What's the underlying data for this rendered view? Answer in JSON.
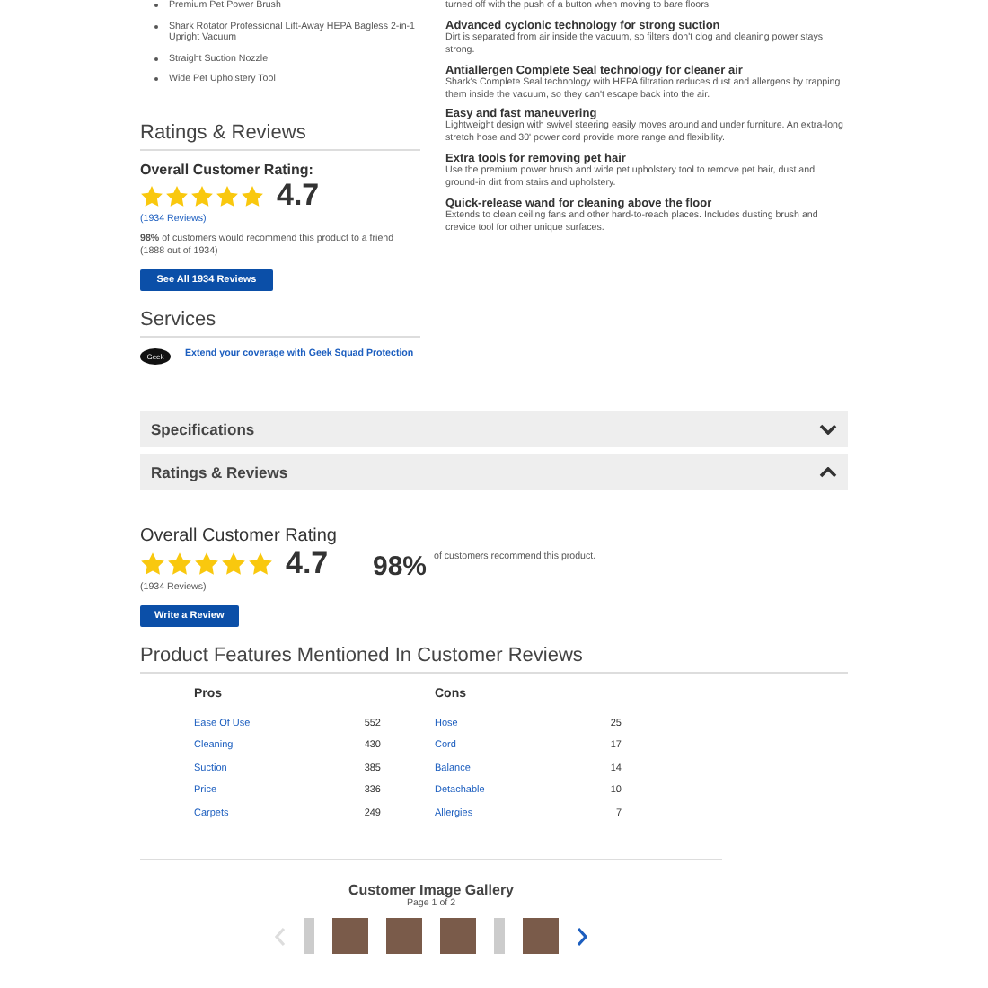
{
  "included_items": [
    "Premium Pet Power Brush",
    "Shark Rotator Professional Lift-Away HEPA Bagless 2-in-1 Upright Vacuum",
    "Straight Suction Nozzle",
    "Wide Pet Upholstery Tool"
  ],
  "features_intro": "turned off with the push of a button when moving to bare floors.",
  "features": [
    {
      "title": "Advanced cyclonic technology for strong suction",
      "text": "Dirt is separated from air inside the vacuum, so filters don't clog and cleaning power stays strong."
    },
    {
      "title": "Antiallergen Complete Seal technology for cleaner air",
      "text": "Shark's Complete Seal technology with HEPA filtration reduces dust and allergens by trapping them inside the vacuum, so they can't escape back into the air."
    },
    {
      "title": "Easy and fast maneuvering",
      "text": "Lightweight design with swivel steering easily moves around and under furniture. An extra-long stretch hose and 30' power cord provide more range and flexibility."
    },
    {
      "title": "Extra tools for removing pet hair",
      "text": "Use the premium power brush and wide pet upholstery tool to remove pet hair, dust and ground-in dirt from stairs and upholstery."
    },
    {
      "title": "Quick-release wand for cleaning above the floor",
      "text": "Extends to clean ceiling fans and other hard-to-reach places. Includes dusting brush and crevice tool for other unique surfaces."
    }
  ],
  "side_ratings": {
    "heading": "Ratings & Reviews",
    "label": "Overall Customer Rating:",
    "stars": 5,
    "score": "4.7",
    "reviews": "(1934 Reviews)",
    "recommend": "**98%** of customers would recommend this product to a friend (1888 out of 1934)",
    "button": "See All 1934 Reviews"
  },
  "services": {
    "heading": "Services",
    "logo": "Geek",
    "link": "Extend your coverage with Geek Squad Protection"
  },
  "accordion": [
    {
      "label": "Specifications",
      "expanded": false
    },
    {
      "label": "Ratings & Reviews",
      "expanded": true
    }
  ],
  "rating": {
    "heading": "Overall Customer Rating",
    "stars": 5,
    "score": "4.7",
    "reviews": "(1934 Reviews)",
    "percent": "98%",
    "percent_text": "of customers recommend this product.",
    "button": "Write a Review"
  },
  "features_mentioned": {
    "heading": "Product Features Mentioned In Customer Reviews",
    "pros": {
      "title": "Pros",
      "rows": [
        {
          "name": "Ease Of Use",
          "count": "552"
        },
        {
          "name": "Cleaning",
          "count": "430"
        },
        {
          "name": "Suction",
          "count": "385"
        },
        {
          "name": "Price",
          "count": "336"
        },
        {
          "name": "Carpets",
          "count": "249"
        }
      ]
    },
    "cons": {
      "title": "Cons",
      "rows": [
        {
          "name": "Hose",
          "count": "25"
        },
        {
          "name": "Cord",
          "count": "17"
        },
        {
          "name": "Balance",
          "count": "14"
        },
        {
          "name": "Detachable",
          "count": "10"
        },
        {
          "name": "Allergies",
          "count": "7"
        }
      ]
    }
  },
  "gallery": {
    "title": "Customer Image Gallery",
    "page": "Page 1 of 2",
    "prev_disabled": true,
    "next_disabled": false,
    "thumbs": [
      {
        "kind": "narrow"
      },
      {
        "kind": "photo"
      },
      {
        "kind": "photo"
      },
      {
        "kind": "photo"
      },
      {
        "kind": "narrow"
      },
      {
        "kind": "photo"
      }
    ]
  }
}
